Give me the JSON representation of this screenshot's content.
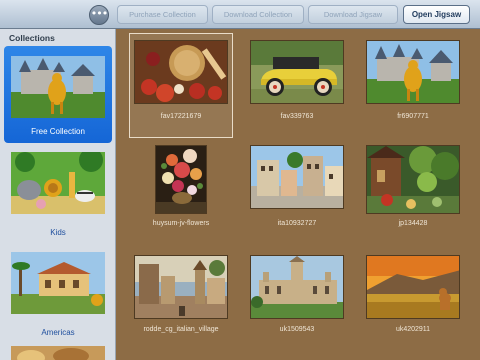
{
  "toolbar": {
    "more_label": "•••",
    "purchase_label": "Purchase Collection",
    "download_collection_label": "Download Collection",
    "download_jigsaw_label": "Download Jigsaw",
    "open_jigsaw_label": "Open Jigsaw"
  },
  "sidebar": {
    "title": "Collections",
    "items": [
      {
        "label": "Free Collection",
        "selected": true
      },
      {
        "label": "Kids",
        "selected": false
      },
      {
        "label": "Americas",
        "selected": false
      }
    ]
  },
  "grid": {
    "items": [
      {
        "caption": "fav17221679",
        "selected": true
      },
      {
        "caption": "fav339763",
        "selected": false
      },
      {
        "caption": "fr6907771",
        "selected": false
      },
      {
        "caption": "huysum-jv-flowers",
        "selected": false
      },
      {
        "caption": "ita10932727",
        "selected": false
      },
      {
        "caption": "jp134428",
        "selected": false
      },
      {
        "caption": "rodde_cg_italian_village",
        "selected": false
      },
      {
        "caption": "uk1509543",
        "selected": false
      },
      {
        "caption": "uk4202911",
        "selected": false
      }
    ]
  },
  "colors": {
    "background": "#8d6c45",
    "selection": "#1566d6",
    "caption": "#f0e6d6"
  }
}
